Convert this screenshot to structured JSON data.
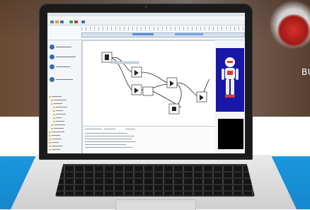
{
  "background": {
    "partial_text": "BU",
    "colors": {
      "blue_band": "#1a97dc",
      "robot_view_bg": "#1717a8",
      "accent": "#2d6fb8"
    }
  },
  "device": {
    "type": "laptop",
    "icon": "laptop-icon"
  },
  "app": {
    "toolbar_icons": [
      "new-icon",
      "open-icon",
      "save-icon",
      "play-icon",
      "stop-icon",
      "connect-icon"
    ],
    "library_items": [
      {
        "icon": "behavior-icon",
        "color": "#2d6fb8"
      },
      {
        "icon": "behavior-icon",
        "color": "#2d6fb8"
      },
      {
        "icon": "behavior-icon",
        "color": "#2d6fb8"
      }
    ],
    "tree_rows": 16,
    "log_rows": 6,
    "diagram_boxes": 7
  }
}
